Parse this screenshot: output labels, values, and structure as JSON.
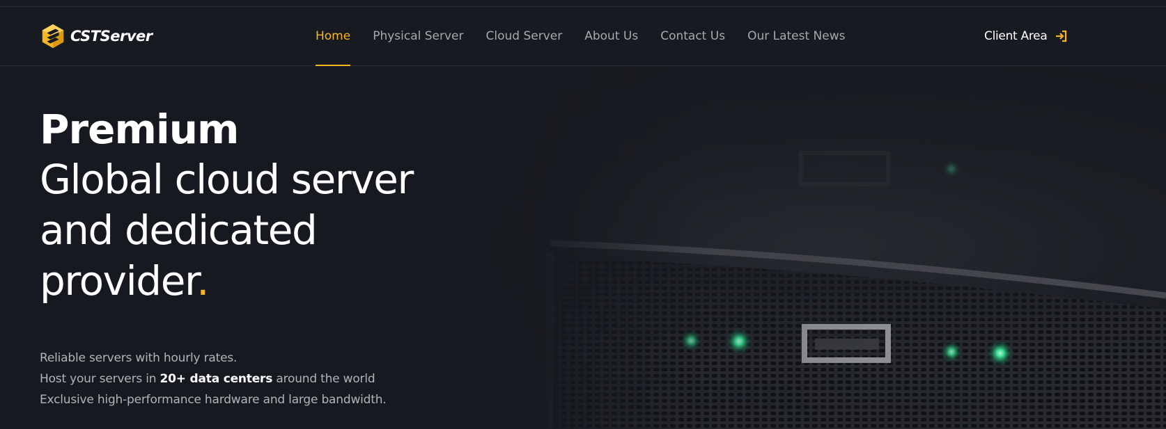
{
  "brand": {
    "name": "CSTServer",
    "accent_color": "#f6b623",
    "background_color": "#181a20"
  },
  "nav": {
    "items": [
      {
        "label": "Home",
        "active": true
      },
      {
        "label": "Physical Server",
        "active": false
      },
      {
        "label": "Cloud Server",
        "active": false
      },
      {
        "label": "About Us",
        "active": false
      },
      {
        "label": "Contact Us",
        "active": false
      },
      {
        "label": "Our Latest News",
        "active": false
      }
    ]
  },
  "client_area": {
    "label": "Client Area",
    "icon": "sign-in-arrow-icon"
  },
  "hero": {
    "title_strong": "Premium",
    "title_lines": [
      "Global cloud server",
      "and dedicated",
      "provider"
    ],
    "title_dot": ".",
    "desc_line_1": "Reliable servers with hourly rates.",
    "desc_line_2_prefix": "Host your servers in ",
    "desc_line_2_strong": "20+ data centers",
    "desc_line_2_suffix": " around the world",
    "desc_line_3": "Exclusive high-performance hardware and large bandwidth."
  }
}
